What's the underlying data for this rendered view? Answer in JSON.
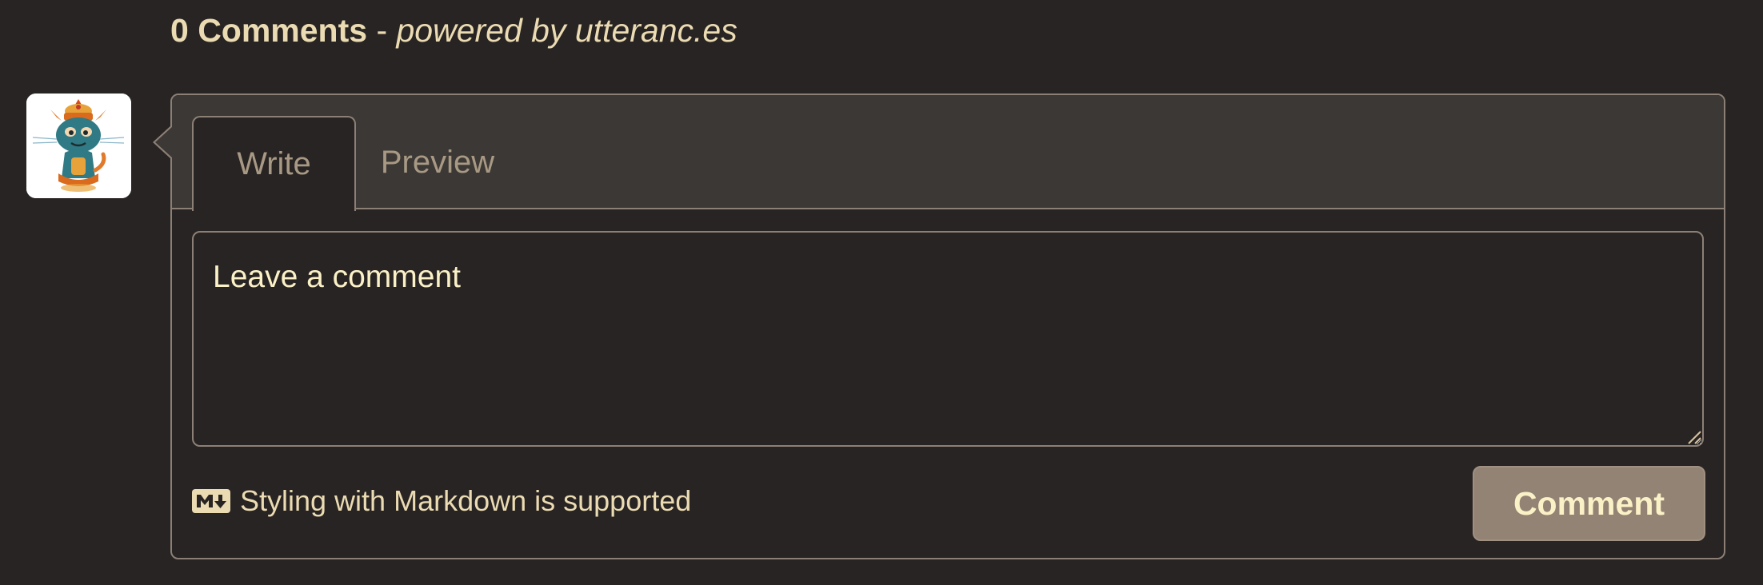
{
  "header": {
    "count_label": "0 Comments",
    "separator": " - ",
    "powered_label": "powered by utteranc.es"
  },
  "avatar": {
    "icon": "user-avatar-icon",
    "alt": "avatar"
  },
  "tabs": [
    {
      "label": "Write",
      "selected": true
    },
    {
      "label": "Preview",
      "selected": false
    }
  ],
  "editor": {
    "placeholder": "Leave a comment",
    "value": ""
  },
  "footer": {
    "markdown_icon": "markdown-icon",
    "markdown_label": "Styling with Markdown is supported",
    "submit_label": "Comment"
  },
  "colors": {
    "background": "#282423",
    "tabbar": "#3c3835",
    "border": "#8c8076",
    "text": "#ebdbb2",
    "muted_text": "#a89984",
    "button_bg": "#928374"
  }
}
